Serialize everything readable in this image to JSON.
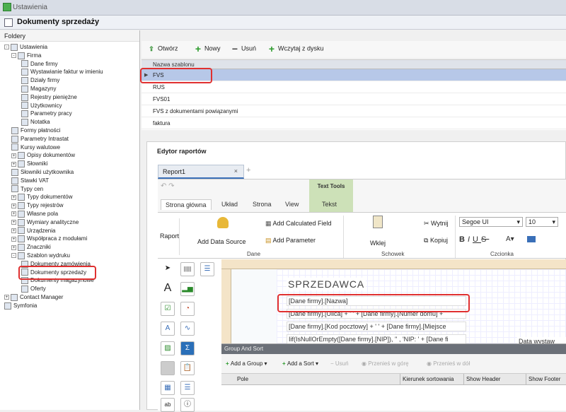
{
  "window": {
    "title": "Ustawienia"
  },
  "module": {
    "title": "Dokumenty sprzedaży"
  },
  "tree": {
    "header": "Foldery",
    "items": [
      {
        "label": "Ustawienia",
        "level": 0,
        "expand": "-"
      },
      {
        "label": "Firma",
        "level": 1,
        "expand": "-"
      },
      {
        "label": "Dane firmy",
        "level": 2,
        "expand": ""
      },
      {
        "label": "Wystawianie faktur w imieniu",
        "level": 2,
        "expand": ""
      },
      {
        "label": "Działy firmy",
        "level": 2,
        "expand": ""
      },
      {
        "label": "Magazyny",
        "level": 2,
        "expand": ""
      },
      {
        "label": "Rejestry pieniężne",
        "level": 2,
        "expand": ""
      },
      {
        "label": "Użytkownicy",
        "level": 2,
        "expand": ""
      },
      {
        "label": "Parametry pracy",
        "level": 2,
        "expand": ""
      },
      {
        "label": "Notatka",
        "level": 2,
        "expand": ""
      },
      {
        "label": "Formy płatności",
        "level": 1,
        "expand": ""
      },
      {
        "label": "Parametry Intrastat",
        "level": 1,
        "expand": ""
      },
      {
        "label": "Kursy walutowe",
        "level": 1,
        "expand": ""
      },
      {
        "label": "Opisy dokumentów",
        "level": 1,
        "expand": "+"
      },
      {
        "label": "Słowniki",
        "level": 1,
        "expand": "+"
      },
      {
        "label": "Słowniki użytkownika",
        "level": 1,
        "expand": ""
      },
      {
        "label": "Stawki VAT",
        "level": 1,
        "expand": ""
      },
      {
        "label": "Typy cen",
        "level": 1,
        "expand": ""
      },
      {
        "label": "Typy dokumentów",
        "level": 1,
        "expand": "+"
      },
      {
        "label": "Typy rejestrów",
        "level": 1,
        "expand": "+"
      },
      {
        "label": "Własne pola",
        "level": 1,
        "expand": "+"
      },
      {
        "label": "Wymiary analityczne",
        "level": 1,
        "expand": "+"
      },
      {
        "label": "Urządzenia",
        "level": 1,
        "expand": "+"
      },
      {
        "label": "Współpraca z modułami",
        "level": 1,
        "expand": "+"
      },
      {
        "label": "Znaczniki",
        "level": 1,
        "expand": "+"
      },
      {
        "label": "Szablon wydruku",
        "level": 1,
        "expand": "-"
      },
      {
        "label": "Dokumenty zamówienia",
        "level": 2,
        "expand": ""
      },
      {
        "label": "Dokumenty sprzedaży",
        "level": 2,
        "expand": ""
      },
      {
        "label": "Dokumenty magazynowe",
        "level": 2,
        "expand": ""
      },
      {
        "label": "Oferty",
        "level": 2,
        "expand": ""
      },
      {
        "label": "Contact Manager",
        "level": 0,
        "expand": "+"
      },
      {
        "label": "Symfonia",
        "level": 0,
        "expand": ""
      }
    ]
  },
  "toolbar": {
    "open": "Otwórz",
    "new": "Nowy",
    "delete": "Usuń",
    "load": "Wczytaj z dysku"
  },
  "templates": {
    "column": "Nazwa szablonu",
    "rows": [
      "FVS",
      "RUS",
      "FVS01",
      "FVS z dokumentami powiązanymi",
      "faktura"
    ]
  },
  "editor": {
    "title": "Edytor raportów",
    "tab": "Report1",
    "context_tab": "Text Tools",
    "ribbon_tabs": [
      "Strona główna",
      "Układ",
      "Strona",
      "View",
      "Tekst"
    ],
    "raport": "Raport",
    "add_data_source": "Add Data Source",
    "add_calc_field": "Add Calculated Field",
    "add_parameter": "Add Parameter",
    "paste": "Wklej",
    "cut": "Wytnij",
    "copy": "Kopiuj",
    "font": "Segoe UI",
    "size": "10",
    "groups": [
      "Dane",
      "Schowek",
      "Czcionka"
    ],
    "canvas": {
      "heading": "SPRZEDAWCA",
      "fields": [
        "[Dane firmy].[Nazwa]",
        "[Dane firmy].[Ulica] + ' ' + [Dane firmy].[Numer domu] +",
        "[Dane firmy].[Kod pocztowy] + ' ' + [Dane firmy].[Miejsce",
        "Iif(IsNullOrEmpty([Dane firmy].[NIP]), '' , 'NIP: ' + [Dane fi"
      ],
      "right_label": "Data wystaw"
    },
    "group_sort": {
      "title": "Group And Sort",
      "add_group": "Add a Group",
      "add_sort": "Add a Sort",
      "delete": "Usuń",
      "move_up": "Przenieś w górę",
      "move_down": "Przenieś w dół",
      "columns": [
        "Pole",
        "Kierunek sortowania",
        "Show Header",
        "Show Footer"
      ]
    }
  }
}
